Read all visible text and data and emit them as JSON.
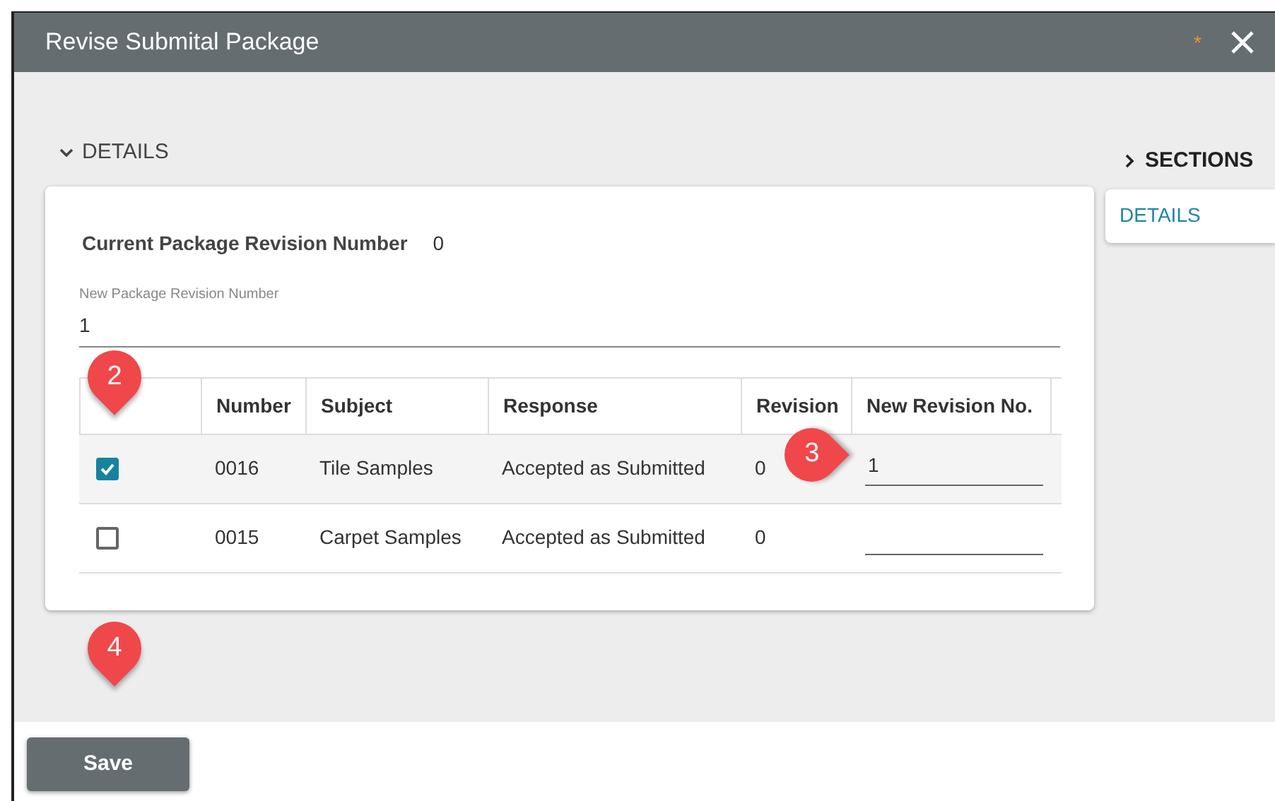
{
  "window": {
    "title": "Revise Submital Package",
    "unsaved_mark": "*"
  },
  "details": {
    "label": "DETAILS",
    "expanded": true,
    "current_revision_label": "Current Package Revision Number",
    "current_revision_value": "0",
    "new_revision_field": {
      "label": "New Package Revision Number",
      "value": "1"
    },
    "table": {
      "columns": [
        "Number",
        "Subject",
        "Response",
        "Revision",
        "New Revision No."
      ],
      "rows": [
        {
          "checked": true,
          "number": "0016",
          "subject": "Tile Samples",
          "response": "Accepted as Submitted",
          "revision": "0",
          "new_revision": "1"
        },
        {
          "checked": false,
          "number": "0015",
          "subject": "Carpet Samples",
          "response": "Accepted as Submitted",
          "revision": "0"
        }
      ]
    }
  },
  "sections": {
    "label": "SECTIONS",
    "expanded": false,
    "items": [
      {
        "label": "DETAILS",
        "selected": true
      }
    ]
  },
  "callouts": [
    {
      "number": "2",
      "kind": "down"
    },
    {
      "number": "3",
      "kind": "right"
    },
    {
      "number": "4",
      "kind": "down"
    }
  ],
  "buttons": [
    {
      "label": "Save"
    }
  ]
}
